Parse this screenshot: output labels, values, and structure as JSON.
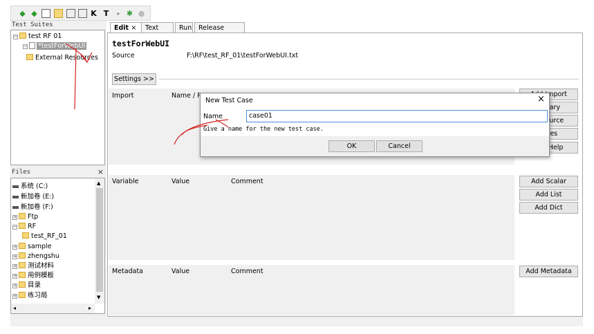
{
  "toolbar": {
    "icons": [
      "left-arrow-icon",
      "right-arrow-icon",
      "folder-icon",
      "file-icon",
      "save-icon",
      "saveall-icon",
      "keyword-icon",
      "text-icon",
      "run-icon",
      "gear-icon",
      "stop-icon"
    ],
    "keyword_glyph": "K",
    "text_glyph": "T"
  },
  "suites": {
    "header": "Test Suites",
    "root": "test RF 01",
    "selected": "*testForWebUI",
    "external": "External Resources"
  },
  "files": {
    "header": "Files",
    "close": "×",
    "items": [
      "系统 (C:)",
      "新加卷 (E:)",
      "新加卷 (F:)",
      "Ftp",
      "RF",
      "test_RF_01",
      "sample",
      "zhengshu",
      "测试材料",
      "用例模板",
      "目录",
      "练习局"
    ]
  },
  "tabs": {
    "edit": "Edit",
    "close": "×",
    "text_edit": "Text Edit",
    "run": "Run",
    "release_notes": "Release Notes"
  },
  "editor": {
    "title": "testForWebUI",
    "source_label": "Source",
    "source_value": "F:\\RF\\test_RF_01\\testForWebUI.txt",
    "settings_button": "Settings >>"
  },
  "import": {
    "col_import": "Import",
    "col_name": "Name / P",
    "col_args": "A",
    "col_comment": "C",
    "add_import": "Add Import",
    "add_library": "Library",
    "add_resource": "Resource",
    "add_variables": "ables",
    "detailed_help": "iled Help"
  },
  "variables": {
    "col_variable": "Variable",
    "col_value": "Value",
    "col_comment": "Comment",
    "add_scalar": "Add Scalar",
    "add_list": "Add List",
    "add_dict": "Add Dict"
  },
  "metadata": {
    "col_metadata": "Metadata",
    "col_value": "Value",
    "col_comment": "Comment",
    "add_metadata": "Add Metadata"
  },
  "dialog": {
    "title": "New Test Case",
    "close": "×",
    "name_label": "Name",
    "name_value": "case01",
    "hint": "Give a name for the new test case.",
    "ok": "OK",
    "cancel": "Cancel"
  },
  "colors": {
    "annotation": "#d42020",
    "selection": "#999999",
    "folder": "#f5d77a"
  }
}
